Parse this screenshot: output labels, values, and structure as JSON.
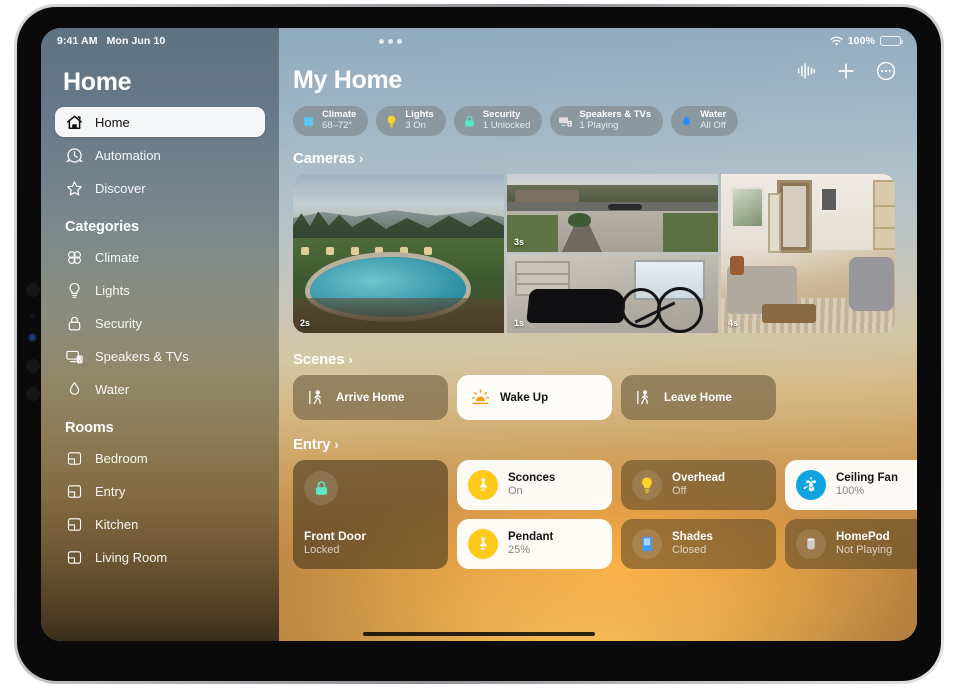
{
  "status_bar": {
    "time": "9:41 AM",
    "date": "Mon Jun 10",
    "battery_percent": "100%",
    "wifi_icon": "wifi-icon",
    "battery_icon": "battery-icon",
    "multitask_icon": "multitasking-dots-icon"
  },
  "sidebar": {
    "title": "Home",
    "primary_items": [
      {
        "label": "Home",
        "icon": "house-icon",
        "selected": true
      },
      {
        "label": "Automation",
        "icon": "clock-arrow-icon",
        "selected": false
      },
      {
        "label": "Discover",
        "icon": "star-icon",
        "selected": false
      }
    ],
    "categories_heading": "Categories",
    "categories": [
      {
        "label": "Climate",
        "icon": "fan-icon"
      },
      {
        "label": "Lights",
        "icon": "lightbulb-icon"
      },
      {
        "label": "Security",
        "icon": "lock-icon"
      },
      {
        "label": "Speakers & TVs",
        "icon": "speaker-tv-icon"
      },
      {
        "label": "Water",
        "icon": "water-drop-icon"
      }
    ],
    "rooms_heading": "Rooms",
    "rooms": [
      {
        "label": "Bedroom",
        "icon": "room-icon"
      },
      {
        "label": "Entry",
        "icon": "room-icon"
      },
      {
        "label": "Kitchen",
        "icon": "room-icon"
      },
      {
        "label": "Living Room",
        "icon": "room-icon"
      }
    ]
  },
  "main": {
    "title": "My Home",
    "toolbar": [
      {
        "name": "audio-waveform-button",
        "icon": "waveform-icon"
      },
      {
        "name": "add-button",
        "icon": "plus-icon"
      },
      {
        "name": "more-options-button",
        "icon": "ellipsis-circle-icon"
      }
    ],
    "status_pills": [
      {
        "title": "Climate",
        "subtitle": "68–72°",
        "icon": "fan-icon",
        "color": "#5ac8fa"
      },
      {
        "title": "Lights",
        "subtitle": "3 On",
        "icon": "lightbulb-icon",
        "color": "#ffd426"
      },
      {
        "title": "Security",
        "subtitle": "1 Unlocked",
        "icon": "lock-icon",
        "color": "#5de6c4"
      },
      {
        "title": "Speakers & TVs",
        "subtitle": "1 Playing",
        "icon": "speaker-tv-icon",
        "color": "#d8d8d8"
      },
      {
        "title": "Water",
        "subtitle": "All Off",
        "icon": "water-drop-icon",
        "color": "#1f8fff"
      }
    ],
    "cameras": {
      "heading": "Cameras",
      "chevron": "›",
      "items": [
        {
          "name": "pool-camera",
          "timestamp": "2s"
        },
        {
          "name": "driveway-camera",
          "timestamp": "3s"
        },
        {
          "name": "garage-camera",
          "timestamp": "1s"
        },
        {
          "name": "living-room-camera",
          "timestamp": "4s"
        }
      ]
    },
    "scenes": {
      "heading": "Scenes",
      "chevron": "›",
      "items": [
        {
          "label": "Arrive Home",
          "icon": "person-arrive-icon",
          "active": false
        },
        {
          "label": "Wake Up",
          "icon": "sunrise-icon",
          "active": true
        },
        {
          "label": "Leave Home",
          "icon": "person-leave-icon",
          "active": false
        }
      ]
    },
    "entry": {
      "heading": "Entry",
      "chevron": "›",
      "accessories": [
        {
          "name": "Front Door",
          "state": "Locked",
          "icon": "lock-icon",
          "on": false
        },
        {
          "name": "Sconces",
          "state": "On",
          "icon": "sconce-lamp-icon",
          "on": true
        },
        {
          "name": "Overhead",
          "state": "Off",
          "icon": "lightbulb-icon",
          "on": false
        },
        {
          "name": "Ceiling Fan",
          "state": "100%",
          "icon": "ceiling-fan-icon",
          "on": true
        },
        {
          "name": "Pendant",
          "state": "25%",
          "icon": "pendant-lamp-icon",
          "on": true
        },
        {
          "name": "Shades",
          "state": "Closed",
          "icon": "window-shade-icon",
          "on": false
        },
        {
          "name": "HomePod",
          "state": "Not Playing",
          "icon": "homepod-icon",
          "on": false
        }
      ]
    }
  },
  "colors": {
    "accent_yellow": "#ffc91c",
    "accent_blue": "#0fa3e0",
    "accent_teal": "#5de6c4",
    "lock_green": "#5de6c4"
  }
}
